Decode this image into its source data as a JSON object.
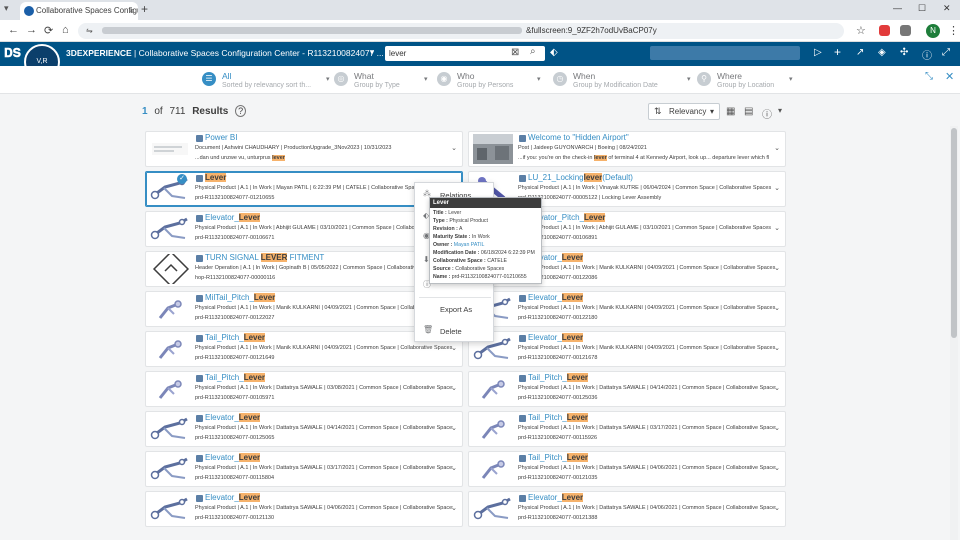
{
  "browser": {
    "tab_title": "Collaborative Spaces Configura",
    "tab_close": "×",
    "new_tab": "+",
    "url_suffix": "&fullscreen:9_9ZF2h7odUvBaCP07y",
    "back": "←",
    "forward": "→",
    "reload": "⟳",
    "home": "⌂",
    "site_info": "⇋",
    "star": "☆",
    "profile": "N",
    "menu": "⋮",
    "minimize": "—",
    "maximize": "☐",
    "close": "✕"
  },
  "app": {
    "brand": "3DEXPERIENCE",
    "separator": "|",
    "title": "Collaborative Spaces Configuration Center - R1132100824077 ...",
    "compass_label": "V,R",
    "search_value": "lever",
    "search_clear": "⊠",
    "search_icon": "⌕",
    "tag_icon": "⬖"
  },
  "filters": [
    {
      "label": "All",
      "sub": "Sorted by relevancy sort th...",
      "glyph": "☰",
      "active": true
    },
    {
      "label": "What",
      "sub": "Group by Type",
      "glyph": "◎",
      "active": false
    },
    {
      "label": "Who",
      "sub": "Group by Persons",
      "glyph": "◉",
      "active": false
    },
    {
      "label": "When",
      "sub": "Group by Modification Date",
      "glyph": "◷",
      "active": false
    },
    {
      "label": "Where",
      "sub": "Group by Location",
      "glyph": "⚲",
      "active": false
    }
  ],
  "results": {
    "page": "1",
    "of": "of",
    "total": "711",
    "word": "Results",
    "help": "?",
    "sort_label": "Relevancy",
    "sort_caret": "▾"
  },
  "cards": [
    {
      "t_pre": "Power BI",
      "t_hl": "",
      "t_post": "",
      "meta": "Document | Ashwini CHAUDHARY | ProductionUpgrade_3Nov2023 | 10/31/2023",
      "name_pre": "...dan und unzwe vu, unturprus ",
      "name_hl": "lever",
      "name_post": "",
      "sel": false,
      "thumb": "doc"
    },
    {
      "t_pre": "Welcome to \"Hidden Airport\"",
      "t_hl": "",
      "t_post": "",
      "meta": "Post | Jaideep GUYONVARCH | Boeing | 08/24/2021",
      "name_pre": "...if you: you're on the check-in ",
      "name_hl": "lever",
      "name_post": " of terminal 4 at Kennedy Airport, look up... departure lever which fl",
      "sel": false,
      "thumb": "photo"
    },
    {
      "t_pre": "",
      "t_hl": "Lever",
      "t_post": "",
      "meta": "Physical Product | A.1 | In Work | Mayan PATIL | 6:22:39 PM | CATELE | Collaborative Spaces",
      "name_pre": "prd-R1132100824077-01210655",
      "name_hl": "",
      "name_post": "",
      "sel": true,
      "thumb": "part"
    },
    {
      "t_pre": "LU_21_Locking",
      "t_hl": "lever",
      "t_post": "(Default)",
      "meta": "Physical Product | A.1 | In Work | Vinayak KUTRE | 06/04/2024 | Common Space | Collaborative Spaces",
      "name_pre": "prd-R1132100824077-00005122 | Locking Lever Assembly",
      "name_hl": "",
      "name_post": "",
      "sel": false,
      "thumb": "tool"
    },
    {
      "t_pre": "Elevator_",
      "t_hl": "Lever",
      "t_post": "",
      "meta": "Physical Product | A.1 | In Work | Abhijit GULAME | 03/10/2021 | Common Space | Collaborative Spaces",
      "name_pre": "prd-R1132100824077-00106671",
      "name_hl": "",
      "name_post": "",
      "sel": false,
      "thumb": "part"
    },
    {
      "t_pre": "Elevator_Pitch_",
      "t_hl": "Lever",
      "t_post": "",
      "meta": "Physical Product | A.1 | In Work | Abhijit GULAME | 03/10/2021 | Common Space | Collaborative Spaces",
      "name_pre": "prd-R1132100824077-00106891",
      "name_hl": "",
      "name_post": "",
      "sel": false,
      "thumb": "part"
    },
    {
      "t_pre": "TURN SIGNAL ",
      "t_hl": "LEVER",
      "t_post": " FITMENT",
      "meta": "Header Operation | A.1 | In Work | Gopinath B | 05/05/2022 | Common Space | Collaborative Spaces",
      "name_pre": "hop-R1132100824077-00000116",
      "name_hl": "",
      "name_post": "",
      "sel": false,
      "thumb": "diamond"
    },
    {
      "t_pre": "Elevator_",
      "t_hl": "Lever",
      "t_post": "",
      "meta": "Physical Product | A.1 | In Work | Manik KULKARNI | 04/09/2021 | Common Space | Collaborative Spaces",
      "name_pre": "prd-R1132100824077-00122086",
      "name_hl": "",
      "name_post": "",
      "sel": false,
      "thumb": "part"
    },
    {
      "t_pre": "MilTail_Pitch_",
      "t_hl": "Lever",
      "t_post": "",
      "meta": "Physical Product | A.1 | In Work | Manik KULKARNI | 04/09/2021 | Common Space | Collaborative Spaces",
      "name_pre": "prd-R1132100824077-00122027",
      "name_hl": "",
      "name_post": "",
      "sel": false,
      "thumb": "small"
    },
    {
      "t_pre": "Elevator_",
      "t_hl": "Lever",
      "t_post": "",
      "meta": "Physical Product | A.1 | In Work | Manik KULKARNI | 04/09/2021 | Common Space | Collaborative Spaces",
      "name_pre": "prd-R1132100824077-00122180",
      "name_hl": "",
      "name_post": "",
      "sel": false,
      "thumb": "part"
    },
    {
      "t_pre": "Tail_Pitch_",
      "t_hl": "Lever",
      "t_post": "",
      "meta": "Physical Product | A.1 | In Work | Manik KULKARNI | 04/09/2021 | Common Space | Collaborative Spaces",
      "name_pre": "prd-R1132100824077-00121649",
      "name_hl": "",
      "name_post": "",
      "sel": false,
      "thumb": "small"
    },
    {
      "t_pre": "Elevator_",
      "t_hl": "Lever",
      "t_post": "",
      "meta": "Physical Product | A.1 | In Work | Manik KULKARNI | 04/09/2021 | Common Space | Collaborative Spaces",
      "name_pre": "prd-R1132100824077-00121678",
      "name_hl": "",
      "name_post": "",
      "sel": false,
      "thumb": "part"
    },
    {
      "t_pre": "Tail_Pitch_",
      "t_hl": "Lever",
      "t_post": "",
      "meta": "Physical Product | A.1 | In Work | Dattatrya SAWALE | 03/08/2021 | Common Space | Collaborative Spaces",
      "name_pre": "prd-R1132100824077-00105971",
      "name_hl": "",
      "name_post": "",
      "sel": false,
      "thumb": "small"
    },
    {
      "t_pre": "Tail_Pitch_",
      "t_hl": "Lever",
      "t_post": "",
      "meta": "Physical Product | A.1 | In Work | Dattatrya SAWALE | 04/14/2021 | Common Space | Collaborative Spaces",
      "name_pre": "prd-R1132100824077-00125036",
      "name_hl": "",
      "name_post": "",
      "sel": false,
      "thumb": "small"
    },
    {
      "t_pre": "Elevator_",
      "t_hl": "Lever",
      "t_post": "",
      "meta": "Physical Product | A.1 | In Work | Dattatrya SAWALE | 04/14/2021 | Common Space | Collaborative Spaces",
      "name_pre": "prd-R1132100824077-00125065",
      "name_hl": "",
      "name_post": "",
      "sel": false,
      "thumb": "part"
    },
    {
      "t_pre": "Tail_Pitch_",
      "t_hl": "Lever",
      "t_post": "",
      "meta": "Physical Product | A.1 | In Work | Dattatrya SAWALE | 03/17/2021 | Common Space | Collaborative Spaces",
      "name_pre": "prd-R1132100824077-00115926",
      "name_hl": "",
      "name_post": "",
      "sel": false,
      "thumb": "small"
    },
    {
      "t_pre": "Elevator_",
      "t_hl": "Lever",
      "t_post": "",
      "meta": "Physical Product | A.1 | In Work | Dattatrya SAWALE | 03/17/2021 | Common Space | Collaborative Spaces",
      "name_pre": "prd-R1132100824077-00115804",
      "name_hl": "",
      "name_post": "",
      "sel": false,
      "thumb": "part"
    },
    {
      "t_pre": "Tail_Pitch_",
      "t_hl": "Lever",
      "t_post": "",
      "meta": "Physical Product | A.1 | In Work | Dattatrya SAWALE | 04/06/2021 | Common Space | Collaborative Spaces",
      "name_pre": "prd-R1132100824077-00121035",
      "name_hl": "",
      "name_post": "",
      "sel": false,
      "thumb": "small"
    },
    {
      "t_pre": "Elevator_",
      "t_hl": "Lever",
      "t_post": "",
      "meta": "Physical Product | A.1 | In Work | Dattatrya SAWALE | 04/06/2021 | Common Space | Collaborative Spaces",
      "name_pre": "prd-R1132100824077-00121130",
      "name_hl": "",
      "name_post": "",
      "sel": false,
      "thumb": "part"
    },
    {
      "t_pre": "Elevator_",
      "t_hl": "Lever",
      "t_post": "",
      "meta": "Physical Product | A.1 | In Work | Dattatrya SAWALE | 04/06/2021 | Common Space | Collaborative Spaces",
      "name_pre": "prd-R1132100824077-00121388",
      "name_hl": "",
      "name_post": "",
      "sel": false,
      "thumb": "part"
    }
  ],
  "context_menu": {
    "items": [
      "Relations",
      "",
      "",
      "",
      "",
      "Export As",
      "Delete"
    ]
  },
  "tooltip": {
    "header": "Lever",
    "rows": [
      {
        "k": "Title :",
        "v": " Lever"
      },
      {
        "k": "Type :",
        "v": " Physical Product"
      },
      {
        "k": "Revision :",
        "v": " A"
      },
      {
        "k": "Maturity State :",
        "v": " In Work"
      },
      {
        "k": "Owner :",
        "v": " Mayan PATIL"
      },
      {
        "k": "Modification Date :",
        "v": " 06/18/2024 6:22:39 PM"
      },
      {
        "k": "Collaborative Space :",
        "v": " CATELE"
      },
      {
        "k": "Source :",
        "v": " Collaborative Spaces"
      },
      {
        "k": "Name :",
        "v": " prd-R1132100824077-01210655"
      }
    ]
  },
  "colors": {
    "header_blue": "#005386",
    "accent": "#368ec4",
    "highlight": "#f6b26b"
  }
}
